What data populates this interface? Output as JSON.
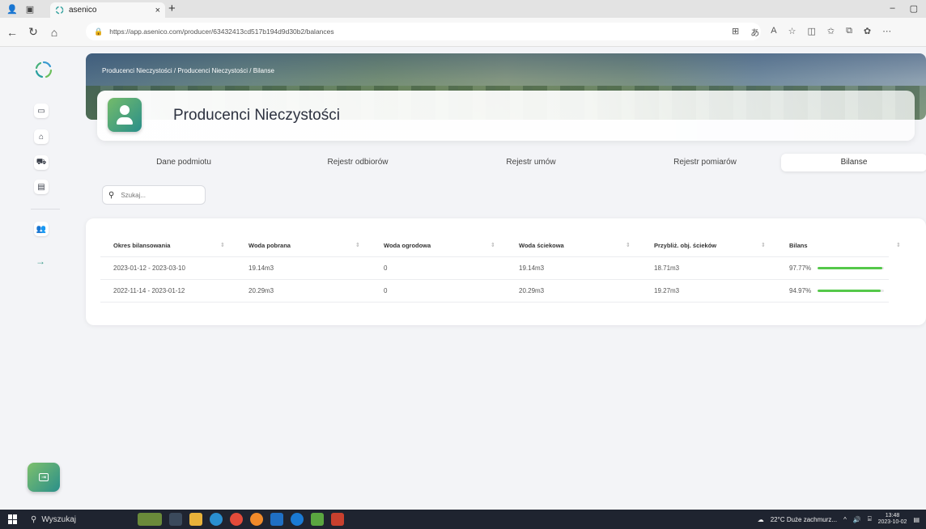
{
  "browser": {
    "tab_title": "asenico",
    "tab_close": "×",
    "new_tab": "+",
    "url": "https://app.asenico.com/producer/63432413cd517b194d9d30b2/balances",
    "minimize": "–",
    "maximize": "▢"
  },
  "breadcrumb": {
    "text": "Producenci Nieczystości  /  Producenci Nieczystości  /  Bilanse"
  },
  "page": {
    "title": "Producenci Nieczystości"
  },
  "tabs": [
    {
      "label": "Dane podmiotu"
    },
    {
      "label": "Rejestr odbiorów"
    },
    {
      "label": "Rejestr umów"
    },
    {
      "label": "Rejestr pomiarów"
    },
    {
      "label": "Bilanse"
    }
  ],
  "search": {
    "placeholder": "Szukaj..."
  },
  "table": {
    "headers": [
      "Okres bilansowania",
      "Woda pobrana",
      "Woda ogrodowa",
      "Woda ściekowa",
      "Przybliż. obj. ścieków",
      "Bilans"
    ],
    "sort_glyph": "⇕",
    "rows": [
      {
        "period": "2023-01-12 - 2023-03-10",
        "woda_pobrana": "19.14m3",
        "woda_ogrodowa": "0",
        "woda_sciekowa": "19.14m3",
        "obj_sciekow": "18.71m3",
        "bilans": "97.77%",
        "bilans_pct": 97.77
      },
      {
        "period": "2022-11-14 - 2023-01-12",
        "woda_pobrana": "20.29m3",
        "woda_ogrodowa": "0",
        "woda_sciekowa": "20.29m3",
        "obj_sciekow": "19.27m3",
        "bilans": "94.97%",
        "bilans_pct": 94.97
      }
    ]
  },
  "taskbar": {
    "search_label": "Wyszukaj",
    "weather": "22°C  Duże zachmurz...",
    "time": "13:48",
    "date": "2023-10-02"
  },
  "colors": {
    "accent": "#2a8f8a",
    "progress": "#55c84a"
  }
}
